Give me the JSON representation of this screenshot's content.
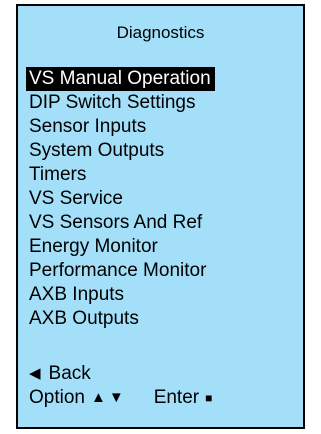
{
  "screen": {
    "title": "Diagnostics",
    "background_color": "#a3dff9",
    "menu": {
      "selected_index": 0,
      "items": [
        {
          "label": "VS Manual Operation"
        },
        {
          "label": "DIP Switch Settings"
        },
        {
          "label": "Sensor Inputs"
        },
        {
          "label": "System Outputs"
        },
        {
          "label": "Timers"
        },
        {
          "label": "VS Service"
        },
        {
          "label": "VS Sensors And Ref"
        },
        {
          "label": "Energy Monitor"
        },
        {
          "label": "Performance Monitor"
        },
        {
          "label": "AXB Inputs"
        },
        {
          "label": "AXB Outputs"
        }
      ]
    },
    "footer": {
      "back_icon": "◀",
      "back_label": "Back",
      "option_label": "Option",
      "option_icons": "▲▼",
      "enter_label": "Enter",
      "enter_icon": "■"
    }
  }
}
